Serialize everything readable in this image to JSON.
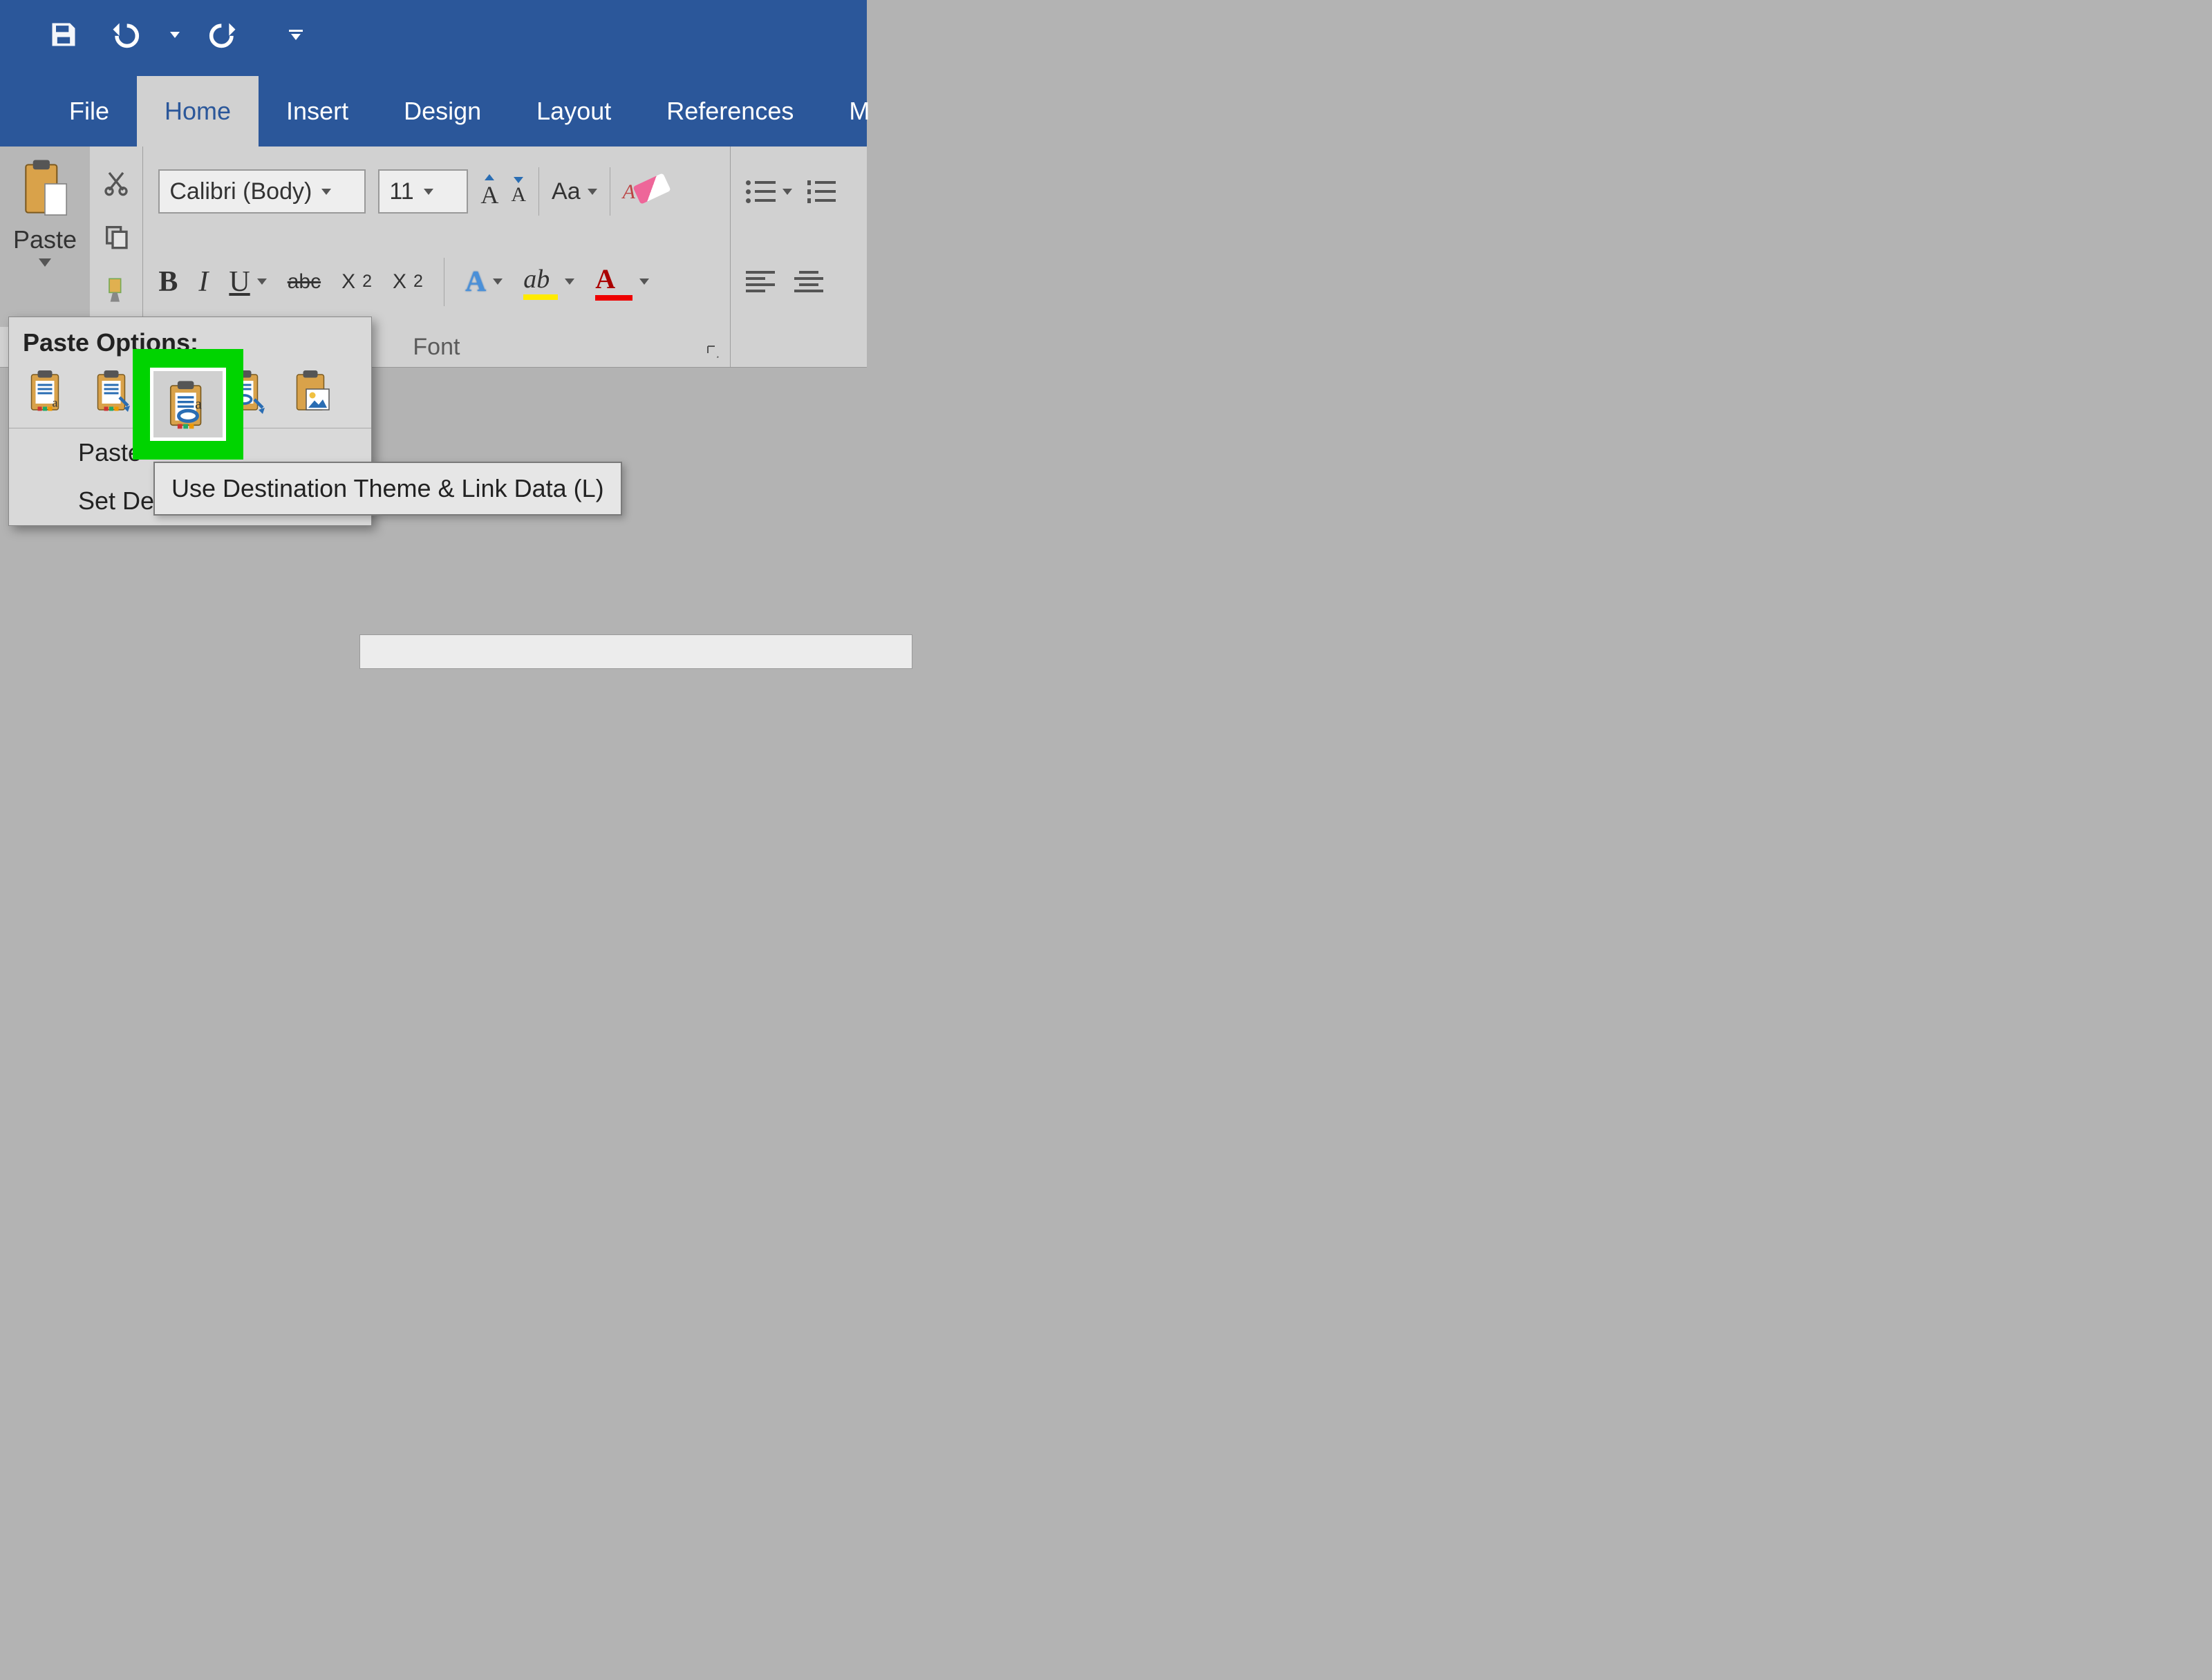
{
  "tabs": {
    "file": "File",
    "home": "Home",
    "insert": "Insert",
    "design": "Design",
    "layout": "Layout",
    "references": "References",
    "more": "M"
  },
  "clipboard": {
    "paste_label": "Paste"
  },
  "font": {
    "name": "Calibri (Body)",
    "size": "11",
    "group_label": "Font",
    "bold": "B",
    "italic": "I",
    "underline": "U",
    "strike": "abc",
    "subscript_base": "X",
    "subscript_sub": "2",
    "superscript_base": "X",
    "superscript_sup": "2",
    "text_effect": "A",
    "highlight": "ab",
    "font_color": "A",
    "change_case": "Aa",
    "grow_font": "A",
    "shrink_font": "A"
  },
  "paste_menu": {
    "header": "Paste Options:",
    "paste_special": "Paste",
    "set_default": "Set Default Paste...",
    "tooltip": "Use Destination Theme & Link Data (L)"
  },
  "colors": {
    "highlight_box": "#00d400",
    "title_bar": "#2b579a"
  }
}
